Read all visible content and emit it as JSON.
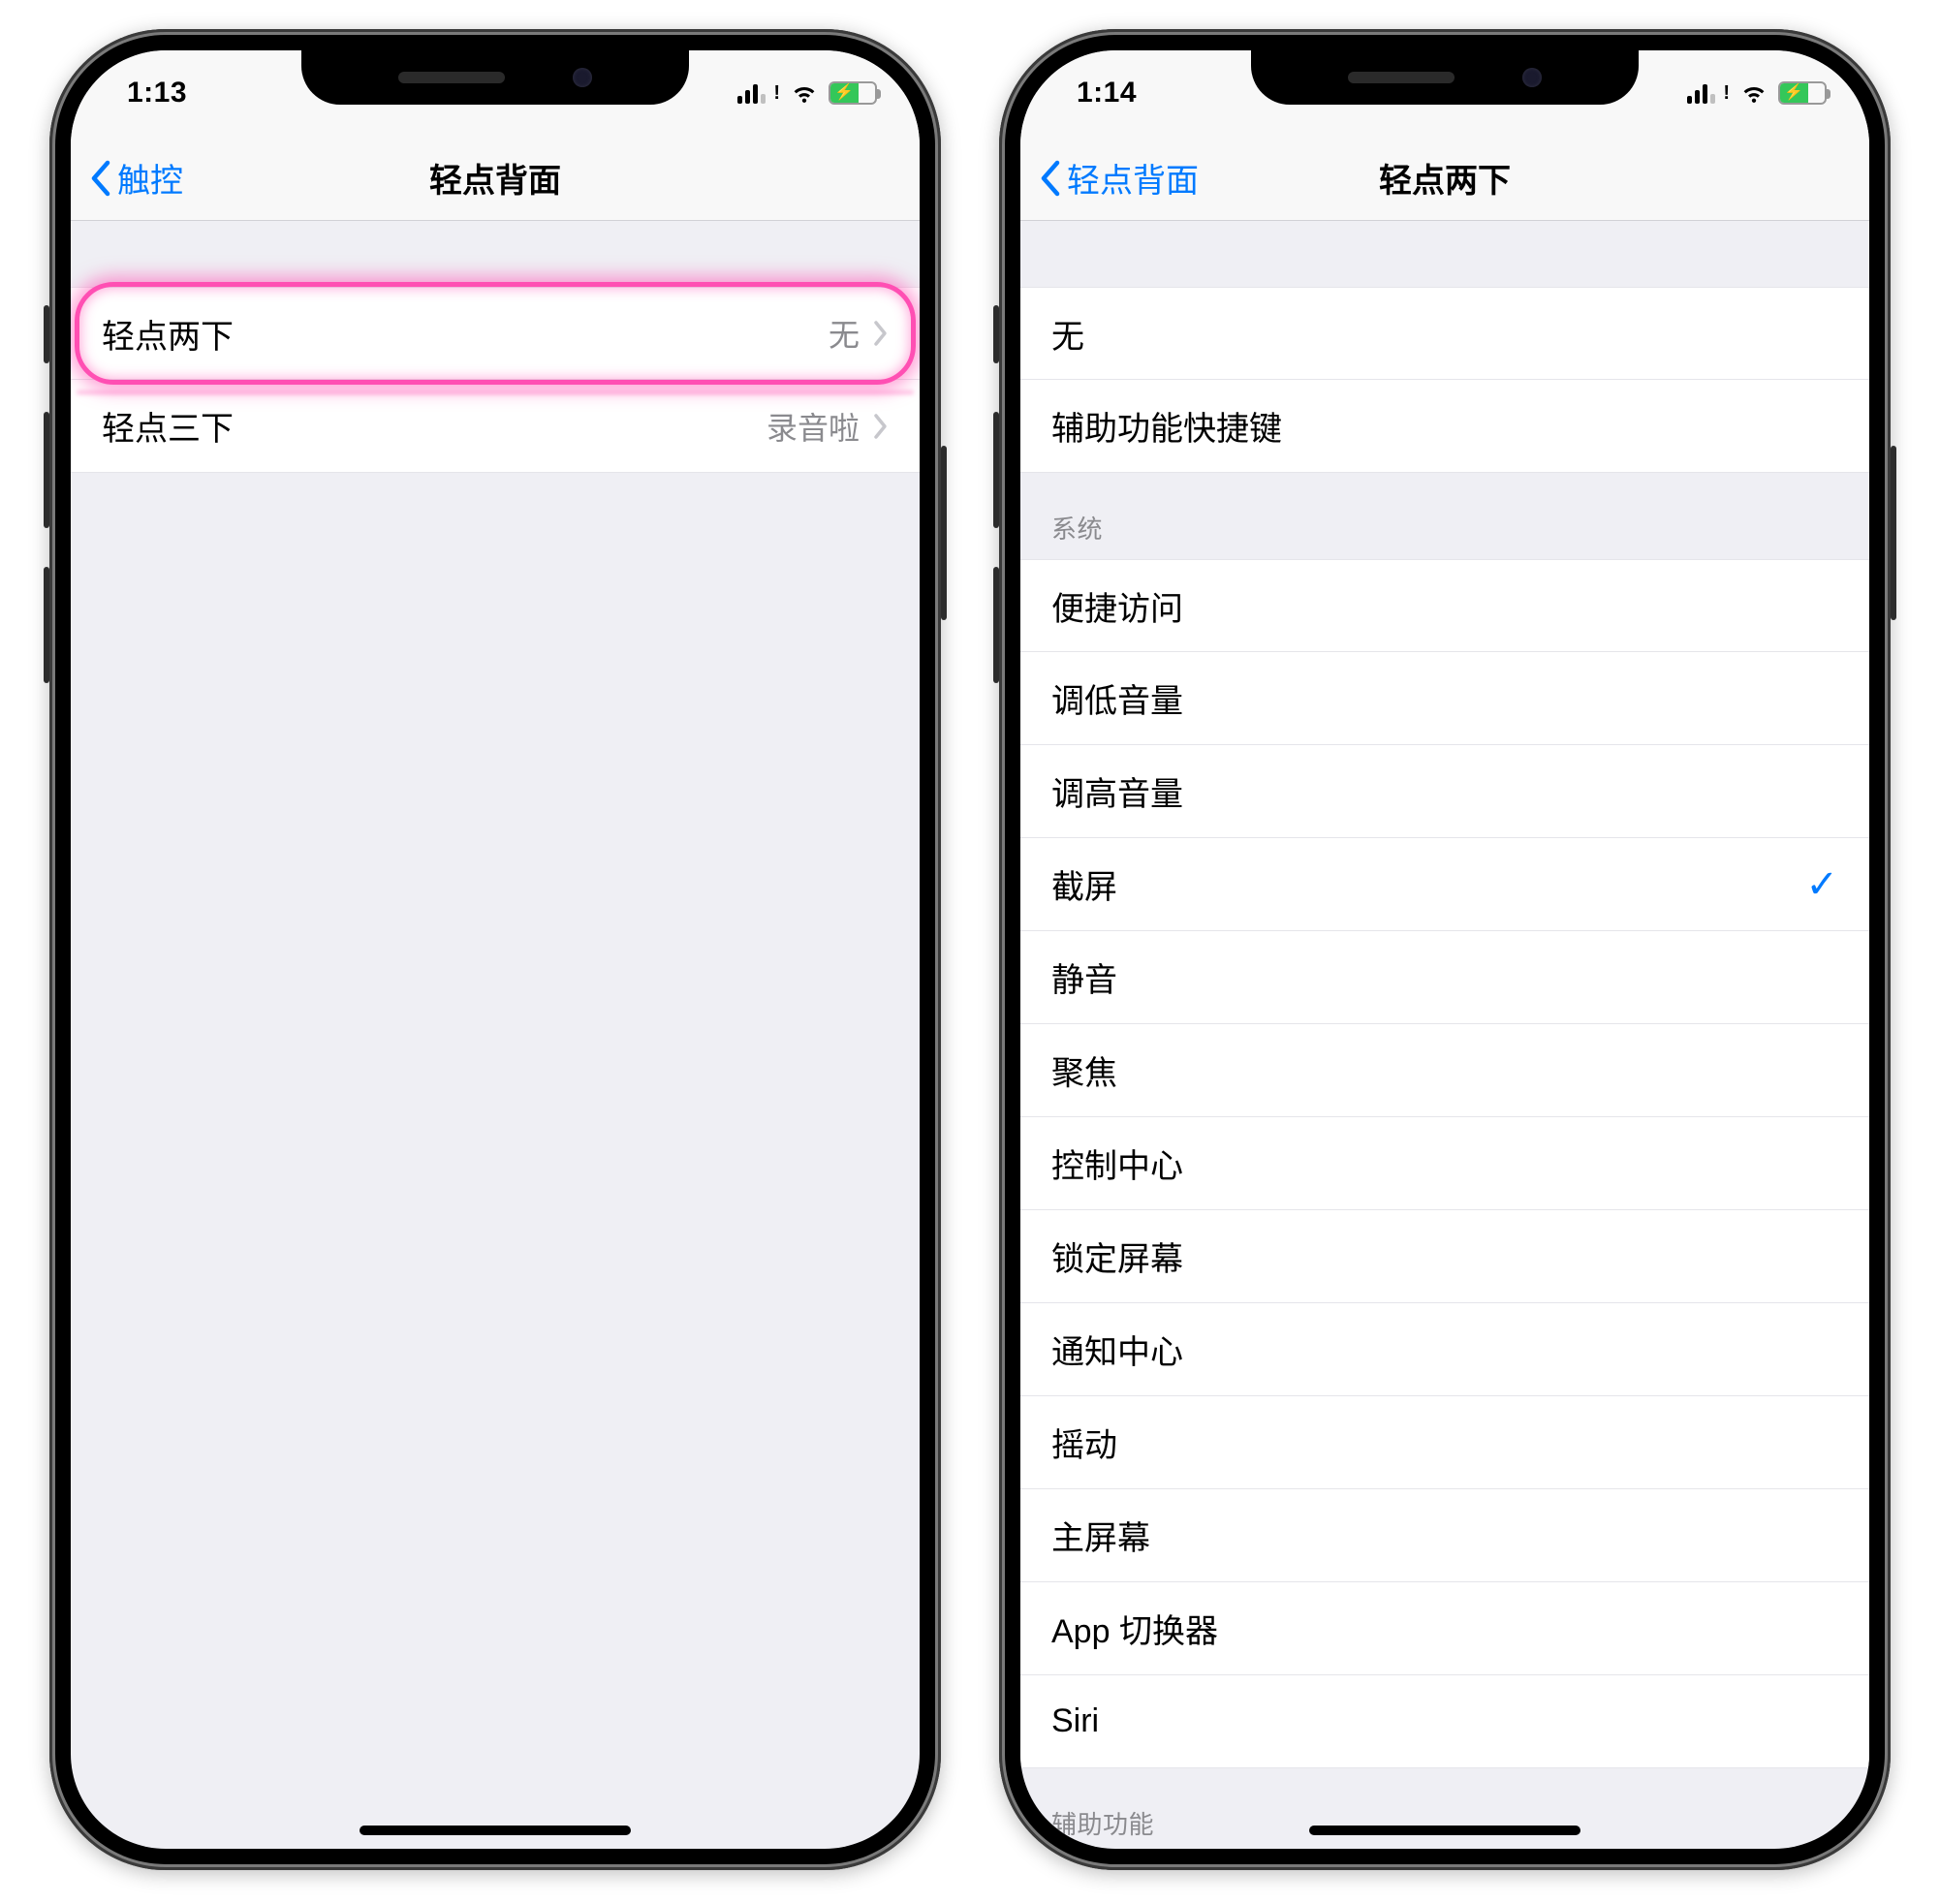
{
  "left": {
    "status": {
      "time": "1:13"
    },
    "nav": {
      "back": "触控",
      "title": "轻点背面"
    },
    "rows": [
      {
        "label": "轻点两下",
        "value": "无",
        "highlight": true
      },
      {
        "label": "轻点三下",
        "value": "录音啦",
        "highlight": false
      }
    ]
  },
  "right": {
    "status": {
      "time": "1:14"
    },
    "nav": {
      "back": "轻点背面",
      "title": "轻点两下"
    },
    "section0": [
      {
        "label": "无"
      },
      {
        "label": "辅助功能快捷键"
      }
    ],
    "system_header": "系统",
    "system": [
      {
        "label": "便捷访问",
        "checked": false
      },
      {
        "label": "调低音量",
        "checked": false
      },
      {
        "label": "调高音量",
        "checked": false
      },
      {
        "label": "截屏",
        "checked": true
      },
      {
        "label": "静音",
        "checked": false
      },
      {
        "label": "聚焦",
        "checked": false
      },
      {
        "label": "控制中心",
        "checked": false
      },
      {
        "label": "锁定屏幕",
        "checked": false
      },
      {
        "label": "通知中心",
        "checked": false
      },
      {
        "label": "摇动",
        "checked": false
      },
      {
        "label": "主屏幕",
        "checked": false
      },
      {
        "label": "App 切换器",
        "checked": false
      },
      {
        "label": "Siri",
        "checked": false
      }
    ],
    "ax_header": "辅助功能"
  }
}
